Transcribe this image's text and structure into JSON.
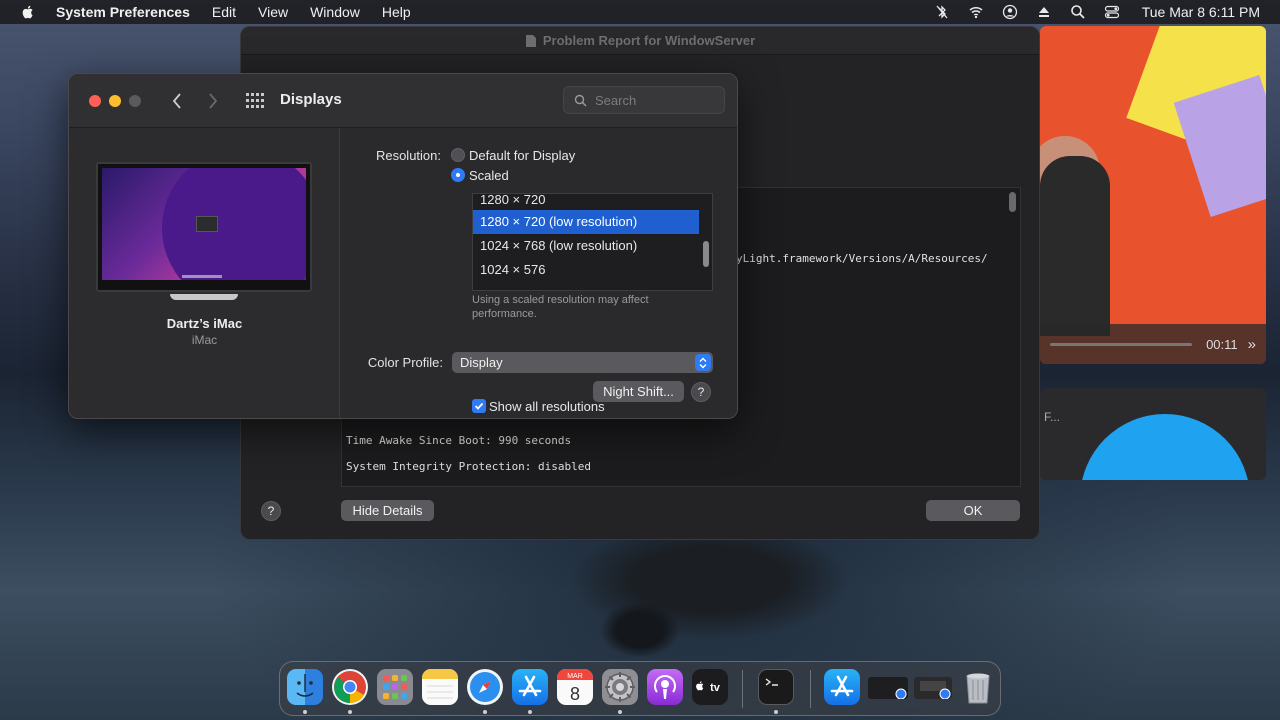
{
  "menubar": {
    "app_name": "System Preferences",
    "menus": [
      "Edit",
      "View",
      "Window",
      "Help"
    ],
    "clock": "Tue Mar 8  6:11 PM"
  },
  "video_window": {
    "time": "00:11",
    "snippet": "F..."
  },
  "problem_report": {
    "title": "Problem Report for WindowServer",
    "text_lines": [
      "yLight.framework/Versions/A/Resources/",
      "Time Awake Since Boot: 990 seconds",
      "System Integrity Protection: disabled"
    ],
    "help_label": "?",
    "hide_details_label": "Hide Details",
    "ok_label": "OK"
  },
  "displays": {
    "title": "Displays",
    "search_placeholder": "Search",
    "device_name": "Dartz’s iMac",
    "device_model": "iMac",
    "resolution_label": "Resolution:",
    "options": [
      {
        "label": "Default for Display",
        "selected": false
      },
      {
        "label": "Scaled",
        "selected": true
      }
    ],
    "resolutions": [
      {
        "label": "1280 × 720",
        "selected": false
      },
      {
        "label": "1280 × 720 (low resolution)",
        "selected": true
      },
      {
        "label": "1024 × 768 (low resolution)",
        "selected": false
      },
      {
        "label": "1024 × 576",
        "selected": false
      }
    ],
    "hint": "Using a scaled resolution may affect performance.",
    "show_all_label": "Show all resolutions",
    "show_all_checked": true,
    "color_profile_label": "Color Profile:",
    "color_profile_value": "Display",
    "night_shift_label": "Night Shift...",
    "help_label": "?"
  },
  "colors": {
    "accent": "#2f7bf5",
    "selection": "#1f5fcf",
    "close": "#ff5f57",
    "minimize": "#febc2e",
    "zoom_disabled": "#5a5a5e"
  },
  "dock": {
    "apps": [
      "finder-icon",
      "chrome-icon",
      "launchpad-icon",
      "notes-icon",
      "safari-icon",
      "app-store-icon",
      "calendar-icon",
      "system-preferences-icon",
      "podcasts-icon",
      "apple-tv-icon",
      "terminal-icon",
      "app-store-folder-icon",
      "minimized-window-icon",
      "minimized-window-icon",
      "trash-icon"
    ],
    "calendar_month": "MAR",
    "calendar_day": "8",
    "tv_label": "tv"
  }
}
